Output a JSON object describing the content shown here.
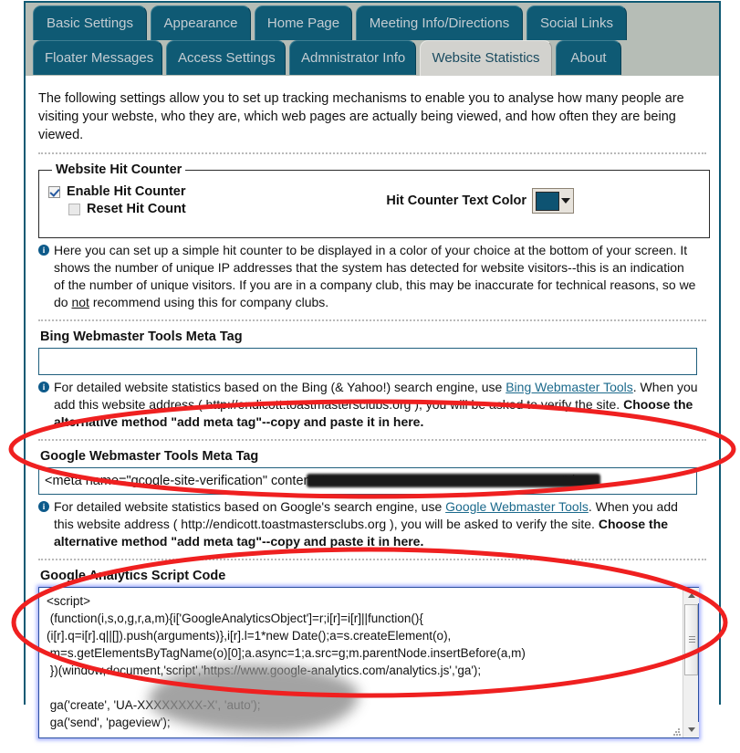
{
  "window": {
    "tabs_row1": [
      {
        "label": "Basic Settings",
        "active": false
      },
      {
        "label": "Appearance",
        "active": false
      },
      {
        "label": "Home Page",
        "active": false
      },
      {
        "label": "Meeting Info/Directions",
        "active": false
      },
      {
        "label": "Social Links",
        "active": false
      }
    ],
    "tabs_row2": [
      {
        "label": "Floater Messages",
        "active": false
      },
      {
        "label": "Access Settings",
        "active": false
      },
      {
        "label": "Admnistrator Info",
        "active": false
      },
      {
        "label": "Website Statistics",
        "active": true
      },
      {
        "label": "About",
        "active": false
      }
    ]
  },
  "intro": "The following settings allow you to set up tracking mechanisms to enable you to analyse how many people are visiting your webste, who they are, which web pages are actually being viewed, and how often they are being viewed.",
  "hit_counter": {
    "legend": "Website Hit Counter",
    "enable_label": "Enable Hit Counter",
    "enable_checked": true,
    "reset_label": "Reset Hit Count",
    "reset_checked": false,
    "color_label": "Hit Counter Text Color",
    "color_value": "#0e5372",
    "note": {
      "part1": "Here you can set up a simple hit counter to be displayed in a color of your choice at the bottom of your screen. It shows the number of unique IP addresses that the system has detected for website visitors--this is an indication of the number of unique visitors. If you are in a company club, this may be inaccurate for technical reasons, so we do ",
      "underlined": "not",
      "part2": " recommend using this for company clubs."
    }
  },
  "bing": {
    "label": "Bing Webmaster Tools Meta Tag",
    "value": "",
    "placeholder": "",
    "note": {
      "part1": "For detailed website statistics based on the Bing (& Yahoo!) search engine, use ",
      "link": "Bing Webmaster Tools",
      "part2": ". When you add this website address ( http://endicott.toastmastersclubs.org ), you will be asked to verify the site. ",
      "bold": "Choose the alternative method \"add meta tag\"--copy and paste it in here."
    }
  },
  "google_webmaster": {
    "label": "Google Webmaster Tools Meta Tag",
    "value_prefix": "<meta name=\"gcogle-site-verification\" content=\"",
    "value_redacted": true,
    "value_suffix": "\" />",
    "note": {
      "part1": "For detailed website statistics based on Google's search engine, use ",
      "link": "Google Webmaster Tools",
      "part2": ". When you add this website address ( http://endicott.toastmastersclubs.org ), you will be asked to verify the site. ",
      "bold": "Choose the alternative method \"add meta tag\"--copy and paste it in here."
    }
  },
  "google_analytics": {
    "label": "Google Analytics Script Code",
    "code": "<script>\n (function(i,s,o,g,r,a,m){i['GoogleAnalyticsObject']=r;i[r]=i[r]||function(){\n(i[r].q=i[r].q||[]).push(arguments)},i[r].l=1*new Date();a=s.createElement(o),\n m=s.getElementsByTagName(o)[0];a.async=1;a.src=g;m.parentNode.insertBefore(a,m)\n })(window,document,'script','https://www.google-analytics.com/analytics.js','ga');\n\n ga('create', 'UA-XXXXXXXX-X', 'auto');\n ga('send', 'pageview');",
    "scrollbar": {
      "up_icon": "triangle-up-icon",
      "down_icon": "triangle-down-icon"
    }
  },
  "annotations": [
    {
      "name": "red-ellipse-google-meta-tag",
      "color": "#ef2020"
    },
    {
      "name": "red-ellipse-analytics-script",
      "color": "#ef2020"
    }
  ]
}
